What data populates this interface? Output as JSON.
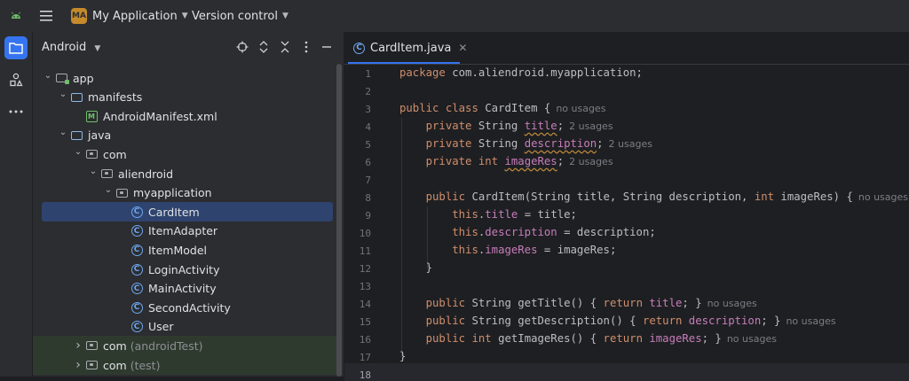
{
  "topbar": {
    "project_badge": "MA",
    "project_name": "My Application",
    "vcs_label": "Version control"
  },
  "panel": {
    "title": "Android"
  },
  "tree": [
    {
      "label": "app",
      "level": 0,
      "kind": "module",
      "expanded": true
    },
    {
      "label": "manifests",
      "level": 1,
      "kind": "folder",
      "expanded": true
    },
    {
      "label": "AndroidManifest.xml",
      "level": 2,
      "kind": "manifest"
    },
    {
      "label": "java",
      "level": 1,
      "kind": "folder",
      "expanded": true
    },
    {
      "label": "com",
      "level": 2,
      "kind": "package",
      "expanded": true
    },
    {
      "label": "aliendroid",
      "level": 3,
      "kind": "package",
      "expanded": true
    },
    {
      "label": "myapplication",
      "level": 4,
      "kind": "package",
      "expanded": true
    },
    {
      "label": "CardItem",
      "level": 5,
      "kind": "class",
      "selected": true
    },
    {
      "label": "ItemAdapter",
      "level": 5,
      "kind": "class"
    },
    {
      "label": "ItemModel",
      "level": 5,
      "kind": "class"
    },
    {
      "label": "LoginActivity",
      "level": 5,
      "kind": "class"
    },
    {
      "label": "MainActivity",
      "level": 5,
      "kind": "class"
    },
    {
      "label": "SecondActivity",
      "level": 5,
      "kind": "class"
    },
    {
      "label": "User",
      "level": 5,
      "kind": "class"
    },
    {
      "label": "com",
      "suffix": "(androidTest)",
      "level": 2,
      "kind": "package",
      "expanded": false,
      "test": true
    },
    {
      "label": "com",
      "suffix": "(test)",
      "level": 2,
      "kind": "package",
      "expanded": false,
      "test": true
    }
  ],
  "editor": {
    "tab_label": "CardItem.java",
    "line_numbers": [
      "1",
      "2",
      "3",
      "4",
      "5",
      "6",
      "7",
      "8",
      "9",
      "10",
      "11",
      "12",
      "13",
      "14",
      "15",
      "16",
      "17",
      "18"
    ],
    "hints": {
      "no_usages": "no usages",
      "two_usages": "2 usages"
    },
    "code": {
      "l1_pkg": "package",
      "l1_name": " com.aliendroid.myapplication;",
      "public": "public",
      "class": "class",
      "private": "private",
      "int": "int",
      "return": "return",
      "this": "this",
      "String": "String",
      "class_name": "CardItem",
      "title": "title",
      "description": "description",
      "imageRes": "imageRes",
      "ctor_args": "(String title, String description, ",
      "ctor_tail": " imageRes) {",
      "getTitle": "getTitle",
      "getDescription": "getDescription",
      "getImageRes": "getImageRes"
    }
  },
  "colors": {
    "accent": "#3574f0",
    "keyword": "#cf8e6d",
    "field": "#c77dbb",
    "selection": "#2e436e"
  }
}
